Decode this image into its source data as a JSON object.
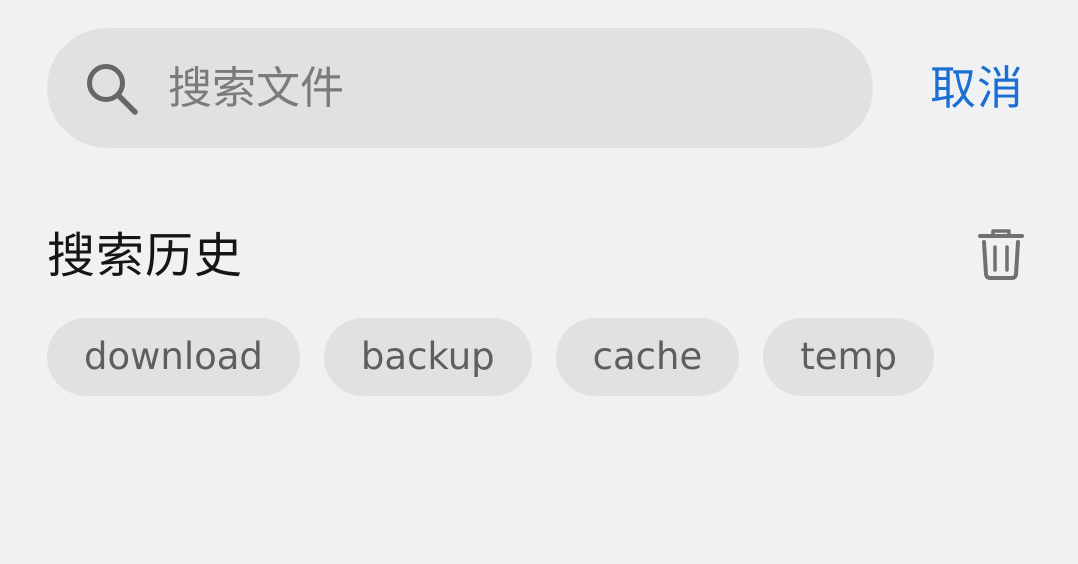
{
  "search": {
    "placeholder": "搜索文件",
    "value": "",
    "icon": "search-icon"
  },
  "cancel_label": "取消",
  "history": {
    "title": "搜索历史",
    "clear_icon": "trash-icon",
    "items": [
      {
        "label": "download"
      },
      {
        "label": "backup"
      },
      {
        "label": "cache"
      },
      {
        "label": "temp"
      }
    ]
  },
  "colors": {
    "background": "#f0f1f3",
    "search_bar": "#e0e1e3",
    "chip": "#e0e1e3",
    "accent": "#1b6fd3",
    "title_text": "#151515",
    "chip_text": "#5d5e60",
    "placeholder": "#7a7b7d"
  }
}
